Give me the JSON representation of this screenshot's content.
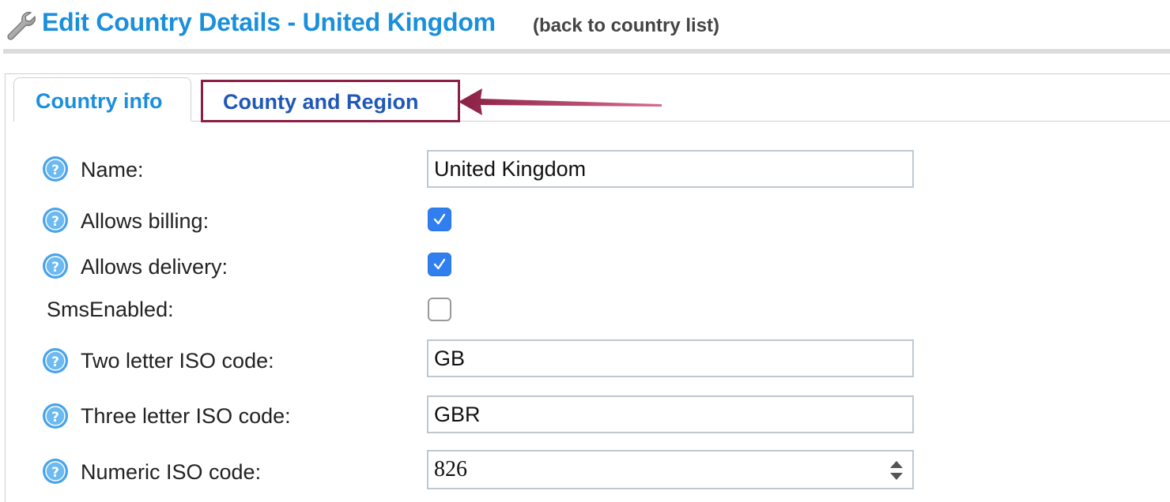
{
  "header": {
    "title": "Edit Country Details - United Kingdom",
    "back_link": "(back to country list)",
    "icon": "wrench-icon"
  },
  "tabs": [
    {
      "label": "Country info",
      "active": true
    },
    {
      "label": "County and Region",
      "active": false,
      "highlighted": true
    }
  ],
  "form": {
    "name": {
      "label": "Name:",
      "value": "United Kingdom"
    },
    "allows_billing": {
      "label": "Allows billing:",
      "checked": true
    },
    "allows_delivery": {
      "label": "Allows delivery:",
      "checked": true
    },
    "sms_enabled": {
      "label": "SmsEnabled:",
      "checked": false
    },
    "two_letter_iso": {
      "label": "Two letter ISO code:",
      "value": "GB"
    },
    "three_letter_iso": {
      "label": "Three letter ISO code:",
      "value": "GBR"
    },
    "numeric_iso": {
      "label": "Numeric ISO code:",
      "value": "826"
    }
  },
  "colors": {
    "title_blue": "#1a8fdc",
    "tab_highlight_border": "#8a2044",
    "checkbox_blue": "#2f7ff0"
  }
}
